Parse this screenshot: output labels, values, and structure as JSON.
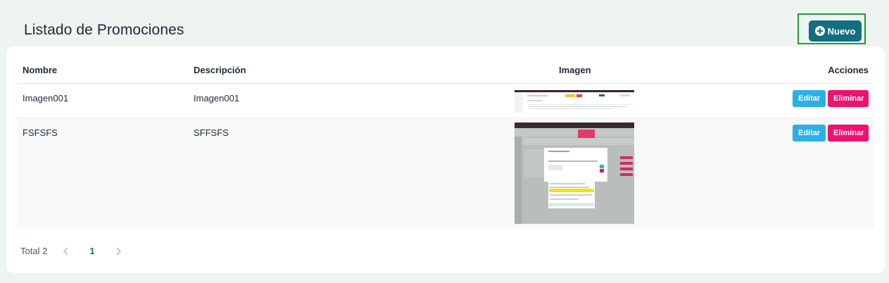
{
  "page": {
    "title": "Listado de Promociones"
  },
  "toolbar": {
    "new_label": "Nuevo",
    "new_icon": "plus-circle-icon"
  },
  "table": {
    "columns": {
      "nombre": "Nombre",
      "descripcion": "Descripción",
      "imagen": "Imagen",
      "acciones": "Acciones"
    },
    "rows": [
      {
        "nombre": "Imagen001",
        "descripcion": "Imagen001",
        "edit_label": "Editar",
        "delete_label": "Eliminar"
      },
      {
        "nombre": "FSFSFS",
        "descripcion": "SFFSFS",
        "edit_label": "Editar",
        "delete_label": "Eliminar"
      }
    ]
  },
  "pagination": {
    "total": "Total 2",
    "current_page": "1",
    "prev_icon": "chevron-left-icon",
    "next_icon": "chevron-right-icon"
  },
  "colors": {
    "primary": "#136f80",
    "edit": "#2ab0e8",
    "delete": "#ef1170",
    "background": "#eef4f2",
    "highlight_border": "#1f9d3a"
  }
}
